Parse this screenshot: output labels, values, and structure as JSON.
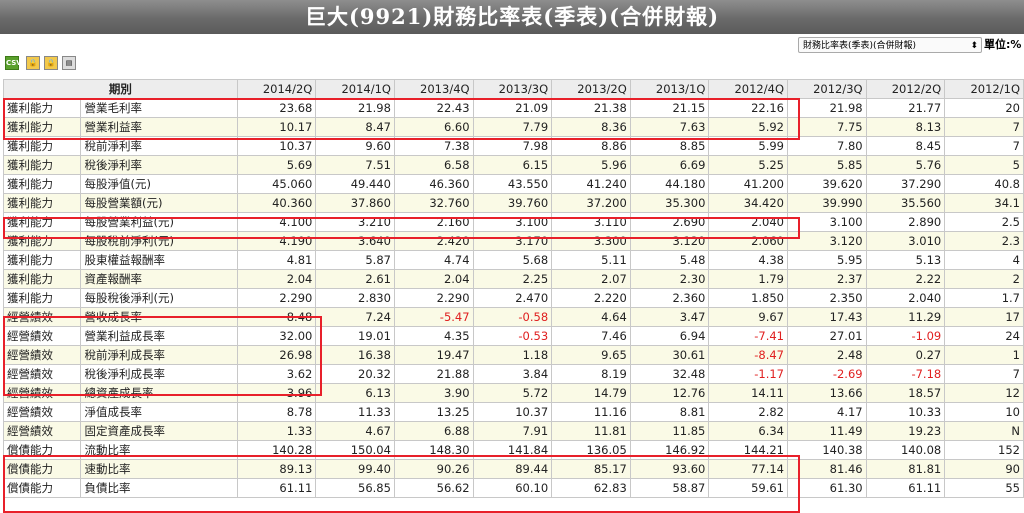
{
  "title": "巨大(9921)財務比率表(季表)(合併財報)",
  "toolbar": {
    "csv_label": "CSV",
    "report_select_value": "財務比率表(季表)(合併財報)",
    "unit_label": "單位:%"
  },
  "colors": {
    "highlight": "#e8202a",
    "negative": "#e02020",
    "title_bar": "#6a6a6a"
  },
  "table": {
    "category_header": "期別",
    "periods": [
      "2014/2Q",
      "2014/1Q",
      "2013/4Q",
      "2013/3Q",
      "2013/2Q",
      "2013/1Q",
      "2012/4Q",
      "2012/3Q",
      "2012/2Q",
      "2012/1Q"
    ],
    "rows": [
      {
        "cat": "獲利能力",
        "item": "營業毛利率",
        "values": [
          "23.68",
          "21.98",
          "22.43",
          "21.09",
          "21.38",
          "21.15",
          "22.16",
          "21.98",
          "21.77",
          "20"
        ]
      },
      {
        "cat": "獲利能力",
        "item": "營業利益率",
        "values": [
          "10.17",
          "8.47",
          "6.60",
          "7.79",
          "8.36",
          "7.63",
          "5.92",
          "7.75",
          "8.13",
          "7"
        ]
      },
      {
        "cat": "獲利能力",
        "item": "稅前淨利率",
        "values": [
          "10.37",
          "9.60",
          "7.38",
          "7.98",
          "8.86",
          "8.85",
          "5.99",
          "7.80",
          "8.45",
          "7"
        ]
      },
      {
        "cat": "獲利能力",
        "item": "稅後淨利率",
        "values": [
          "5.69",
          "7.51",
          "6.58",
          "6.15",
          "5.96",
          "6.69",
          "5.25",
          "5.85",
          "5.76",
          "5"
        ]
      },
      {
        "cat": "獲利能力",
        "item": "每股淨值(元)",
        "values": [
          "45.060",
          "49.440",
          "46.360",
          "43.550",
          "41.240",
          "44.180",
          "41.200",
          "39.620",
          "37.290",
          "40.8"
        ]
      },
      {
        "cat": "獲利能力",
        "item": "每股營業額(元)",
        "values": [
          "40.360",
          "37.860",
          "32.760",
          "39.760",
          "37.200",
          "35.300",
          "34.420",
          "39.990",
          "35.560",
          "34.1"
        ]
      },
      {
        "cat": "獲利能力",
        "item": "每股營業利益(元)",
        "values": [
          "4.100",
          "3.210",
          "2.160",
          "3.100",
          "3.110",
          "2.690",
          "2.040",
          "3.100",
          "2.890",
          "2.5"
        ]
      },
      {
        "cat": "獲利能力",
        "item": "每股稅前淨利(元)",
        "values": [
          "4.190",
          "3.640",
          "2.420",
          "3.170",
          "3.300",
          "3.120",
          "2.060",
          "3.120",
          "3.010",
          "2.3"
        ]
      },
      {
        "cat": "獲利能力",
        "item": "股東權益報酬率",
        "values": [
          "4.81",
          "5.87",
          "4.74",
          "5.68",
          "5.11",
          "5.48",
          "4.38",
          "5.95",
          "5.13",
          "4"
        ]
      },
      {
        "cat": "獲利能力",
        "item": "資產報酬率",
        "values": [
          "2.04",
          "2.61",
          "2.04",
          "2.25",
          "2.07",
          "2.30",
          "1.79",
          "2.37",
          "2.22",
          "2"
        ]
      },
      {
        "cat": "獲利能力",
        "item": "每股稅後淨利(元)",
        "values": [
          "2.290",
          "2.830",
          "2.290",
          "2.470",
          "2.220",
          "2.360",
          "1.850",
          "2.350",
          "2.040",
          "1.7"
        ]
      },
      {
        "cat": "經營績效",
        "item": "營收成長率",
        "values": [
          "8.48",
          "7.24",
          "-5.47",
          "-0.58",
          "4.64",
          "3.47",
          "9.67",
          "17.43",
          "11.29",
          "17"
        ]
      },
      {
        "cat": "經營績效",
        "item": "營業利益成長率",
        "values": [
          "32.00",
          "19.01",
          "4.35",
          "-0.53",
          "7.46",
          "6.94",
          "-7.41",
          "27.01",
          "-1.09",
          "24"
        ]
      },
      {
        "cat": "經營績效",
        "item": "稅前淨利成長率",
        "values": [
          "26.98",
          "16.38",
          "19.47",
          "1.18",
          "9.65",
          "30.61",
          "-8.47",
          "2.48",
          "0.27",
          "1"
        ]
      },
      {
        "cat": "經營績效",
        "item": "稅後淨利成長率",
        "values": [
          "3.62",
          "20.32",
          "21.88",
          "3.84",
          "8.19",
          "32.48",
          "-1.17",
          "-2.69",
          "-7.18",
          "7"
        ]
      },
      {
        "cat": "經營績效",
        "item": "總資產成長率",
        "values": [
          "3.96",
          "6.13",
          "3.90",
          "5.72",
          "14.79",
          "12.76",
          "14.11",
          "13.66",
          "18.57",
          "12"
        ]
      },
      {
        "cat": "經營績效",
        "item": "淨值成長率",
        "values": [
          "8.78",
          "11.33",
          "13.25",
          "10.37",
          "11.16",
          "8.81",
          "2.82",
          "4.17",
          "10.33",
          "10"
        ]
      },
      {
        "cat": "經營績效",
        "item": "固定資產成長率",
        "values": [
          "1.33",
          "4.67",
          "6.88",
          "7.91",
          "11.81",
          "11.85",
          "6.34",
          "11.49",
          "19.23",
          "N"
        ]
      },
      {
        "cat": "償債能力",
        "item": "流動比率",
        "values": [
          "140.28",
          "150.04",
          "148.30",
          "141.84",
          "136.05",
          "146.92",
          "144.21",
          "140.38",
          "140.08",
          "152"
        ]
      },
      {
        "cat": "償債能力",
        "item": "速動比率",
        "values": [
          "89.13",
          "99.40",
          "90.26",
          "89.44",
          "85.17",
          "93.60",
          "77.14",
          "81.46",
          "81.81",
          "90"
        ]
      },
      {
        "cat": "償債能力",
        "item": "負債比率",
        "values": [
          "61.11",
          "56.85",
          "56.62",
          "60.10",
          "62.83",
          "58.87",
          "59.61",
          "61.30",
          "61.11",
          "55"
        ]
      }
    ]
  }
}
